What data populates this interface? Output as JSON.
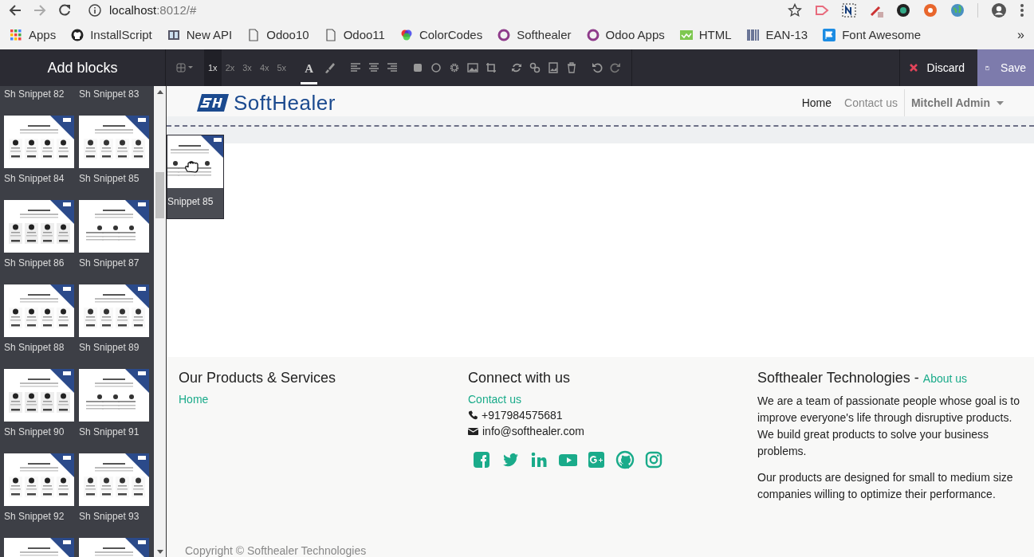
{
  "browser": {
    "url_host": "localhost",
    "url_path": ":8012/#",
    "bookmarks": [
      {
        "label": "Apps",
        "kind": "apps"
      },
      {
        "label": "InstallScript",
        "kind": "github"
      },
      {
        "label": "New API",
        "kind": "book"
      },
      {
        "label": "Odoo10",
        "kind": "page"
      },
      {
        "label": "Odoo11",
        "kind": "page"
      },
      {
        "label": "ColorCodes",
        "kind": "color"
      },
      {
        "label": "Softhealer",
        "kind": "ring"
      },
      {
        "label": "Odoo Apps",
        "kind": "ring"
      },
      {
        "label": "HTML",
        "kind": "html"
      },
      {
        "label": "EAN-13",
        "kind": "barcode"
      },
      {
        "label": "Font Awesome",
        "kind": "flag"
      }
    ],
    "overflow": "»"
  },
  "editor": {
    "panel_title": "Add blocks",
    "font_glyph": "A",
    "zoom_options": [
      {
        "label": "1x",
        "selected": true
      },
      {
        "label": "2x",
        "selected": false
      },
      {
        "label": "3x",
        "selected": false
      },
      {
        "label": "4x",
        "selected": false
      },
      {
        "label": "5x",
        "selected": false
      }
    ],
    "discard": "Discard",
    "save": "Save"
  },
  "snippets": [
    {
      "label": "Sh Snippet 82",
      "preview": false
    },
    {
      "label": "Sh Snippet 83",
      "preview": false
    },
    {
      "label": "Sh Snippet 84",
      "preview": true
    },
    {
      "label": "Sh Snippet 85",
      "preview": true
    },
    {
      "label": "Sh Snippet 86",
      "preview": true
    },
    {
      "label": "Sh Snippet 87",
      "preview": true
    },
    {
      "label": "Sh Snippet 88",
      "preview": true
    },
    {
      "label": "Sh Snippet 89",
      "preview": true
    },
    {
      "label": "Sh Snippet 90",
      "preview": true
    },
    {
      "label": "Sh Snippet 91",
      "preview": true
    },
    {
      "label": "Sh Snippet 92",
      "preview": true
    },
    {
      "label": "Sh Snippet 93",
      "preview": true
    }
  ],
  "dragged_snippet": {
    "label": "Snippet 85"
  },
  "site": {
    "logo_text": "SoftHealer",
    "nav": [
      {
        "label": "Home",
        "selected": true
      },
      {
        "label": "Contact us",
        "selected": false
      }
    ],
    "user": "Mitchell Admin"
  },
  "footer": {
    "columns": [
      {
        "title": "Our Products & Services",
        "links": [
          "Home"
        ]
      },
      {
        "title": "Connect with us",
        "links": [
          "Contact us"
        ],
        "contacts": [
          {
            "kind": "phone",
            "text": "+917984575681"
          },
          {
            "kind": "mail",
            "text": "info@softhealer.com"
          }
        ],
        "social": true
      },
      {
        "title": "Softhealer Technologies",
        "separator": "-",
        "title_link": "About us",
        "paragraphs": [
          "We are a team of passionate people whose goal is to improve everyone's life through disruptive products. We build great products to solve your business problems.",
          "Our products are designed for small to medium size companies willing to optimize their performance."
        ]
      }
    ],
    "copyright": "Copyright © Softhealer Technologies"
  }
}
